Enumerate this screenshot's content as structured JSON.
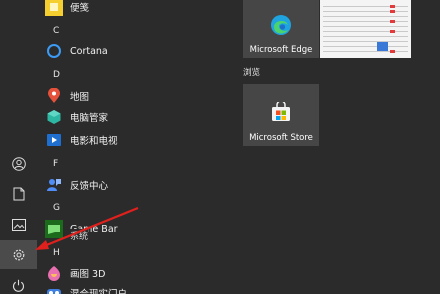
{
  "rail": {
    "items": [
      {
        "icon": "user-icon"
      },
      {
        "icon": "documents-icon"
      },
      {
        "icon": "pictures-icon"
      },
      {
        "icon": "settings-icon"
      },
      {
        "icon": "power-icon"
      }
    ]
  },
  "app_list": {
    "sections": [
      {
        "letter": "",
        "apps": [
          {
            "label": "便笺",
            "icon": "sticky-notes-icon"
          }
        ]
      },
      {
        "letter": "C",
        "apps": [
          {
            "label": "Cortana",
            "icon": "cortana-icon"
          }
        ]
      },
      {
        "letter": "D",
        "apps": [
          {
            "label": "地图",
            "icon": "maps-icon"
          },
          {
            "label": "电脑管家",
            "icon": "pc-manager-icon"
          },
          {
            "label": "电影和电视",
            "icon": "movies-tv-icon"
          }
        ]
      },
      {
        "letter": "F",
        "apps": [
          {
            "label": "反馈中心",
            "icon": "feedback-hub-icon"
          }
        ]
      },
      {
        "letter": "G",
        "apps": [
          {
            "label": "Game Bar",
            "icon": "game-bar-icon"
          }
        ]
      },
      {
        "letter": "H",
        "apps": [
          {
            "label": "画图 3D",
            "icon": "paint-3d-icon"
          },
          {
            "label": "混合现实门户",
            "icon": "mixed-reality-icon"
          }
        ]
      }
    ],
    "tooltip": "系统"
  },
  "tiles": {
    "edge_label": "Microsoft Edge",
    "group_title": "浏览",
    "store_label": "Microsoft Store"
  },
  "colors": {
    "background": "#2b2b2b",
    "tile": "#464646",
    "arrow": "#e0201c"
  }
}
